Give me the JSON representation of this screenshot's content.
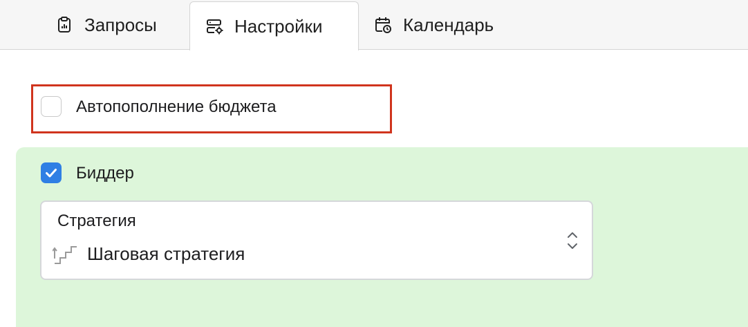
{
  "tabs": [
    {
      "label": "Запросы",
      "icon": "clipboard-chart-icon"
    },
    {
      "label": "Настройки",
      "icon": "server-settings-icon",
      "active": true
    },
    {
      "label": "Календарь",
      "icon": "calendar-clock-icon"
    }
  ],
  "autofill": {
    "label": "Автопополнение бюджета",
    "checked": false,
    "highlight_color": "#d0341d"
  },
  "bidder": {
    "label": "Биддер",
    "checked": true,
    "panel_color": "#ddf6da",
    "checkbox_color": "#2f7fe4"
  },
  "strategy": {
    "label": "Стратегия",
    "value": "Шаговая стратегия",
    "icon": "stairs-icon"
  }
}
